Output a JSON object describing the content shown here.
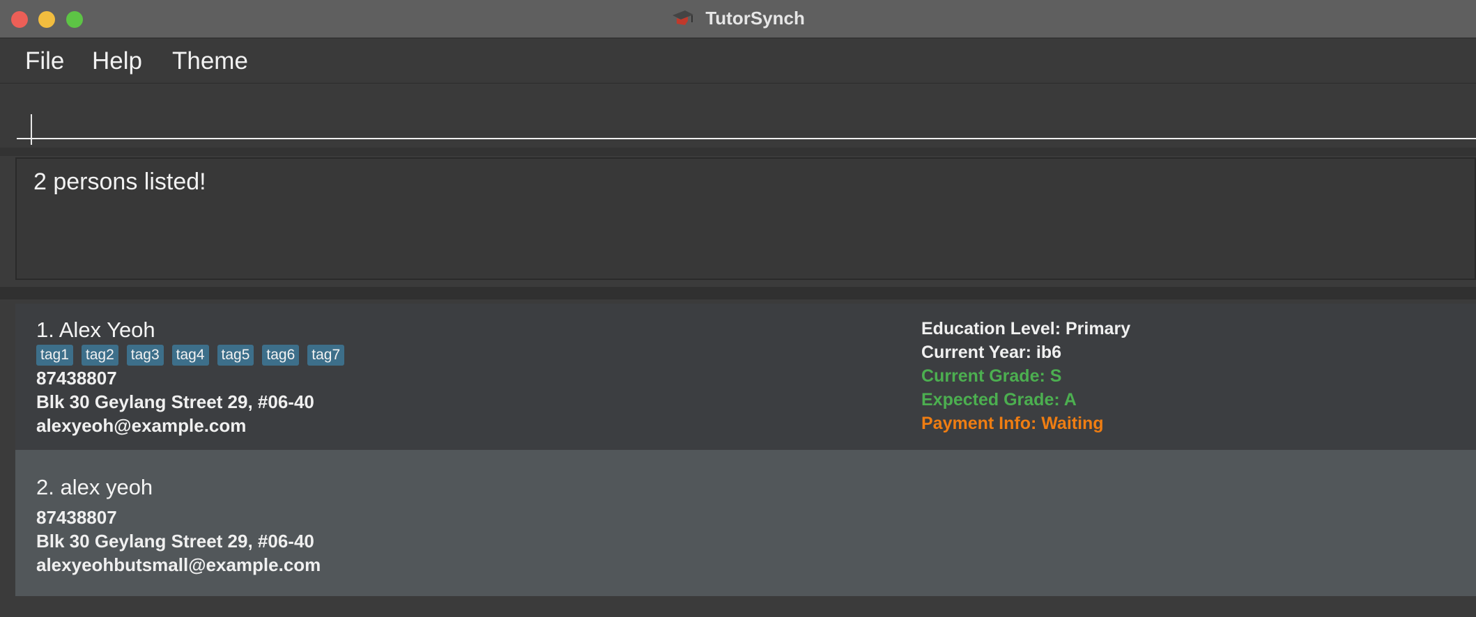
{
  "window": {
    "title": "TutorSynch"
  },
  "menu": [
    "File",
    "Help",
    "Theme"
  ],
  "command": {
    "value": ""
  },
  "result": {
    "message": "2 persons listed!"
  },
  "persons": [
    {
      "name": "1. Alex Yeoh",
      "tags": [
        "tag1",
        "tag2",
        "tag3",
        "tag4",
        "tag5",
        "tag6",
        "tag7"
      ],
      "phone": "87438807",
      "address": "Blk 30 Geylang Street 29, #06-40",
      "email": "alexyeoh@example.com",
      "education_level": "Education Level: Primary",
      "current_year": "Current Year: ib6",
      "current_grade": "Current Grade: S",
      "expected_grade": "Expected Grade: A",
      "payment_info": "Payment Info: Waiting"
    },
    {
      "name": "2. alex yeoh",
      "phone": "87438807",
      "address": "Blk 30 Geylang Street 29, #06-40",
      "email": "alexyeohbutsmall@example.com"
    }
  ],
  "colors": {
    "tag_bg": "#3d6f8a",
    "grade_green": "#4caf50",
    "payment_orange": "#ef7d12"
  }
}
